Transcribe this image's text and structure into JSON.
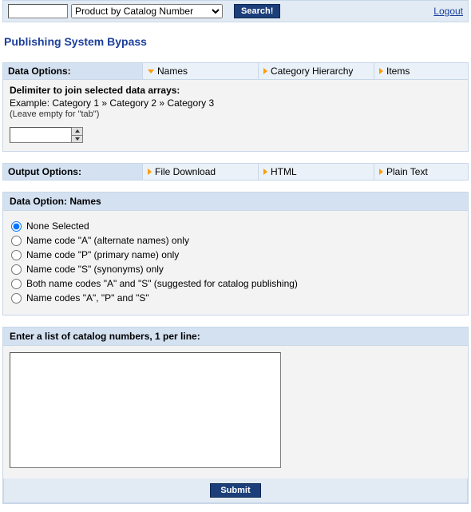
{
  "topbar": {
    "search_value": "",
    "search_dropdown_selected": "Product by Catalog Number",
    "search_button": "Search!",
    "logout": "Logout"
  },
  "title": "Publishing System Bypass",
  "data_options": {
    "header": "Data Options:",
    "tabs": [
      {
        "label": "Names",
        "expanded": true
      },
      {
        "label": "Category Hierarchy",
        "expanded": false
      },
      {
        "label": "Items",
        "expanded": false
      }
    ]
  },
  "delimiter": {
    "heading": "Delimiter to join selected data arrays:",
    "example": "Example: Category 1 » Category 2 » Category 3",
    "hint": "(Leave empty for \"tab\")",
    "value": ""
  },
  "output_options": {
    "header": "Output Options:",
    "tabs": [
      {
        "label": "File Download"
      },
      {
        "label": "HTML"
      },
      {
        "label": "Plain Text"
      }
    ]
  },
  "names_box": {
    "header": "Data Option: Names",
    "options": [
      "None Selected",
      "Name code \"A\" (alternate names) only",
      "Name code \"P\" (primary name) only",
      "Name code \"S\" (synonyms) only",
      "Both name codes \"A\" and \"S\" (suggested for catalog publishing)",
      "Name codes \"A\", \"P\" and \"S\""
    ],
    "selected_index": 0
  },
  "catalog_box": {
    "header": "Enter a list of catalog numbers, 1 per line:",
    "value": ""
  },
  "submit_label": "Submit"
}
